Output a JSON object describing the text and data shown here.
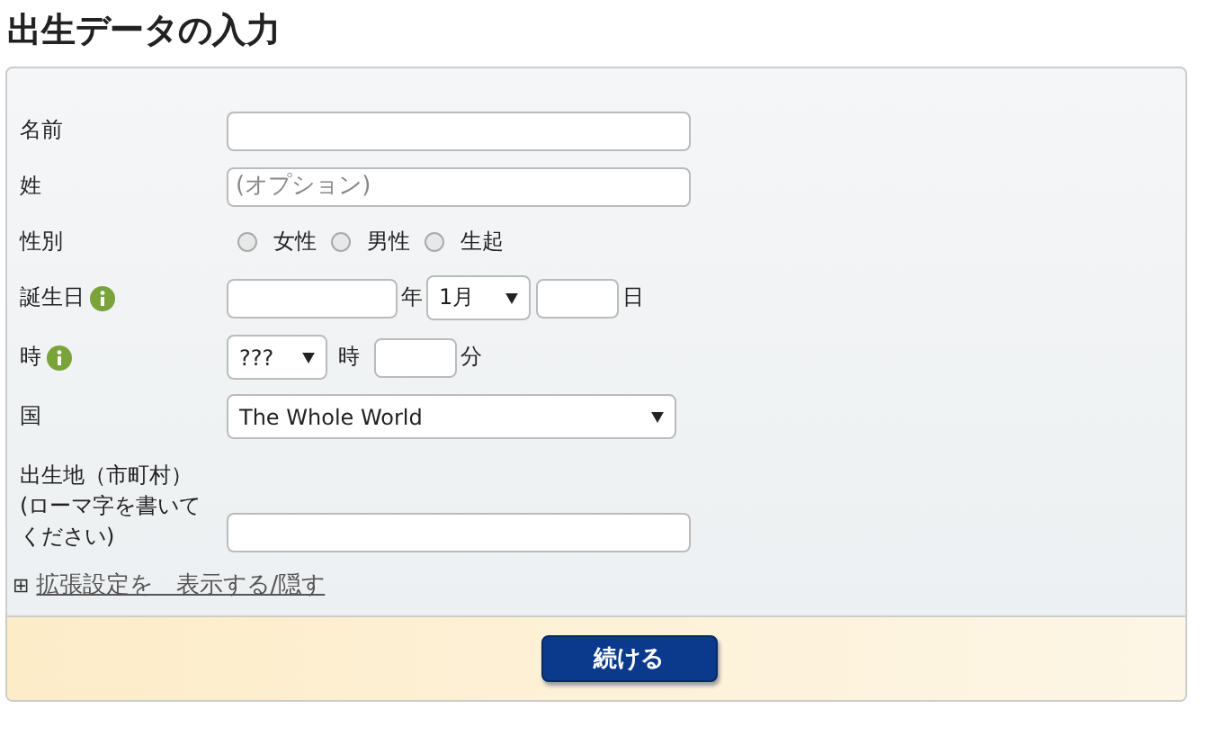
{
  "title": "出生データの入力",
  "name_field": {
    "label": "名前"
  },
  "surname_field": {
    "label": "姓",
    "placeholder": "(オプション)"
  },
  "gender": {
    "label": "性別",
    "options": [
      {
        "label": "女性",
        "selected": false
      },
      {
        "label": "男性",
        "selected": false
      },
      {
        "label": "生起",
        "selected": false
      }
    ]
  },
  "birthdate": {
    "label": "誕生日",
    "year_unit": "年",
    "month": "1月",
    "day_unit": "日"
  },
  "time": {
    "label": "時",
    "hour": "???",
    "hour_unit": "時",
    "minute_unit": "分"
  },
  "country": {
    "label": "国",
    "value": "The Whole World"
  },
  "birthplace": {
    "label": "出生地（市町村）\n(ローマ字を書いてください)"
  },
  "toggle_link": {
    "icon": "⊞",
    "text": "拡張設定を　表示する/隠す"
  },
  "submit_button": "続ける"
}
